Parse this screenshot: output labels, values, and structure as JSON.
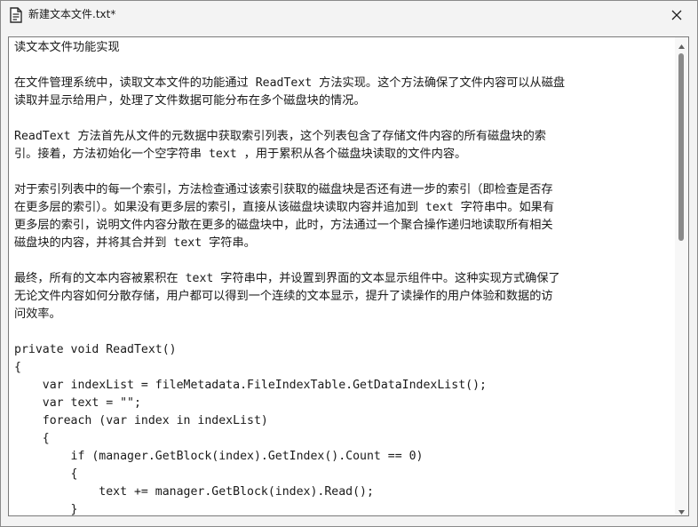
{
  "window": {
    "title": "新建文本文件.txt*"
  },
  "icons": {
    "app": "document-icon",
    "close": "close-icon",
    "scroll_up": "chevron-up-icon",
    "scroll_down": "chevron-down-icon"
  },
  "editor": {
    "lines": [
      "读文本文件功能实现",
      "",
      "在文件管理系统中，读取文本文件的功能通过 ReadText 方法实现。这个方法确保了文件内容可以从磁盘",
      "读取并显示给用户，处理了文件数据可能分布在多个磁盘块的情况。",
      "",
      "ReadText 方法首先从文件的元数据中获取索引列表，这个列表包含了存储文件内容的所有磁盘块的索",
      "引。接着，方法初始化一个空字符串 text ，用于累积从各个磁盘块读取的文件内容。",
      "",
      "对于索引列表中的每一个索引，方法检查通过该索引获取的磁盘块是否还有进一步的索引（即检查是否存",
      "在更多层的索引）。如果没有更多层的索引，直接从该磁盘块读取内容并追加到 text 字符串中。如果有",
      "更多层的索引，说明文件内容分散在更多的磁盘块中，此时，方法通过一个聚合操作递归地读取所有相关",
      "磁盘块的内容，并将其合并到 text 字符串。",
      "",
      "最终，所有的文本内容被累积在 text 字符串中，并设置到界面的文本显示组件中。这种实现方式确保了",
      "无论文件内容如何分散存储，用户都可以得到一个连续的文本显示，提升了读操作的用户体验和数据的访",
      "问效率。",
      "",
      "private void ReadText()",
      "{",
      "    var indexList = fileMetadata.FileIndexTable.GetDataIndexList();",
      "    var text = \"\";",
      "    foreach (var index in indexList)",
      "    {",
      "        if (manager.GetBlock(index).GetIndex().Count == 0)",
      "        {",
      "            text += manager.GetBlock(index).Read();",
      "        }"
    ]
  },
  "scrollbar": {
    "position_fraction": 0.0,
    "visible_fraction": 0.42
  }
}
